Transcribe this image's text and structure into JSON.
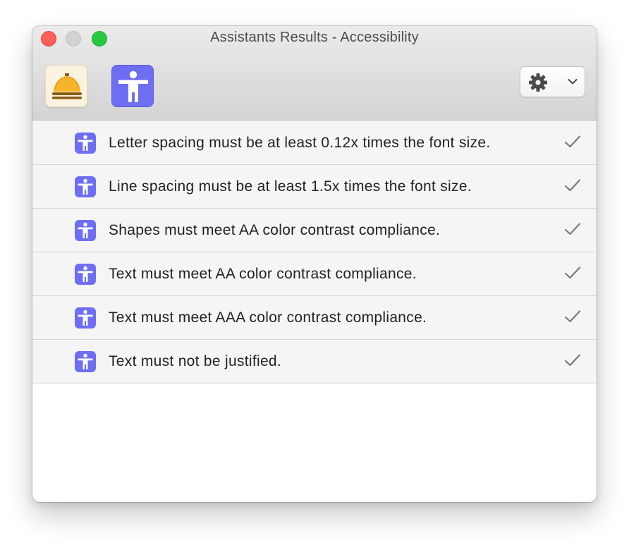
{
  "window": {
    "title": "Assistants Results - Accessibility"
  },
  "toolbar": {
    "buttons": [
      {
        "icon": "bell-icon"
      },
      {
        "icon": "accessibility-icon"
      }
    ],
    "settings_menu": {
      "icon": "gear-icon",
      "indicator": "chevron-down-icon"
    }
  },
  "results": [
    {
      "text": "Letter spacing must be at least 0.12x times the font size.",
      "status": "passed"
    },
    {
      "text": "Line spacing must be at least 1.5x times the font size.",
      "status": "passed"
    },
    {
      "text": "Shapes must meet AA color contrast compliance.",
      "status": "passed"
    },
    {
      "text": "Text must meet AA color contrast compliance.",
      "status": "passed"
    },
    {
      "text": "Text must meet AAA color contrast compliance.",
      "status": "passed"
    },
    {
      "text": "Text must not be justified.",
      "status": "passed"
    }
  ],
  "colors": {
    "accessibility_accent": "#6e6ef4",
    "bell": "#f5b42a",
    "checkmark": "#7a7a7a"
  }
}
